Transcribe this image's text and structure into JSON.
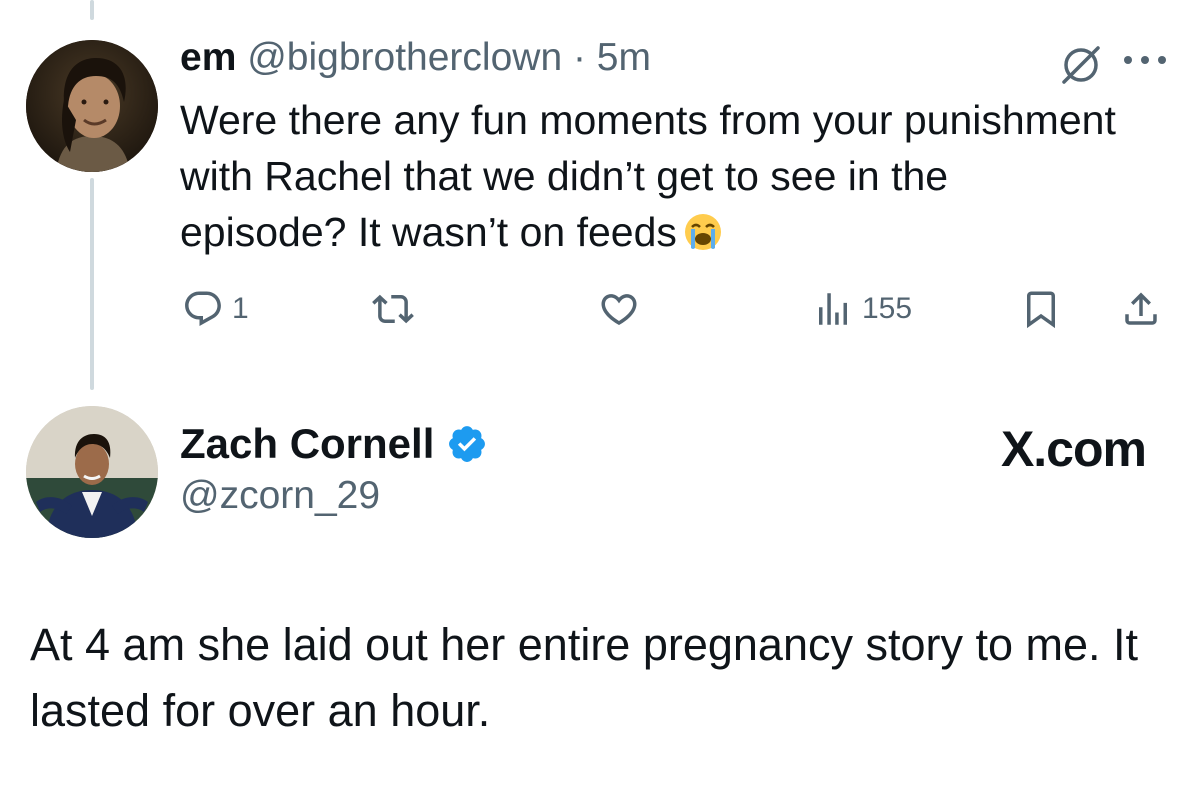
{
  "original_tweet": {
    "name": "em",
    "handle_time": "@bigbrotherclown · 5m",
    "text": "Were there any fun moments from your punishment with Rachel that we didn’t get to see in the episode? It wasn’t on feeds",
    "emoji": "loudly-crying-face",
    "actions": {
      "reply_count": "1",
      "retweet_count": "",
      "like_count": "",
      "views_count": "155"
    },
    "icons": [
      "grok-icon",
      "more-icon",
      "reply-icon",
      "retweet-icon",
      "like-icon",
      "views-icon",
      "bookmark-icon",
      "share-icon"
    ]
  },
  "reply_tweet": {
    "name": "Zach Cornell",
    "verified": true,
    "handle": "@zcorn_29",
    "source_label": "X.com",
    "text": "At 4 am she laid out her entire pregnancy story to me. It lasted for over an hour."
  },
  "colors": {
    "text_primary": "#0f1419",
    "text_secondary": "#536471",
    "verified_blue": "#1d9bf0",
    "thread_line": "#cfd9de"
  }
}
